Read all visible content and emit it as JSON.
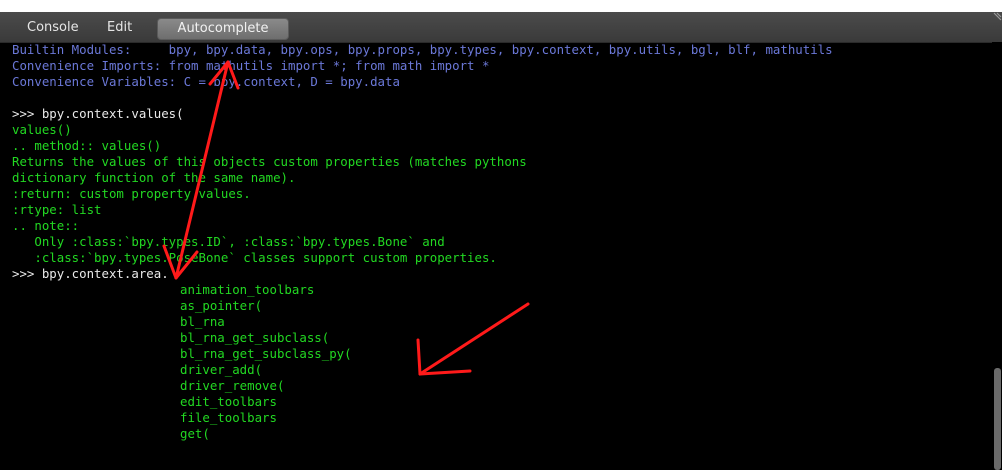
{
  "menu": {
    "console": "Console",
    "edit": "Edit",
    "autocomplete": "Autocomplete"
  },
  "header": {
    "builtin": "Builtin Modules:     bpy, bpy.data, bpy.ops, bpy.props, bpy.types, bpy.context, bpy.utils, bgl, blf, mathutils",
    "imports": "Convenience Imports: from mathutils import *; from math import *",
    "variables": "Convenience Variables: C = bpy.context, D = bpy.data"
  },
  "history": {
    "cmd1": ">>> bpy.context.values(",
    "doc": [
      "values()",
      ".. method:: values()",
      "Returns the values of this objects custom properties (matches pythons",
      "dictionary function of the same name).",
      ":return: custom property values.",
      ":rtype: list",
      ".. note::",
      "   Only :class:`bpy.types.ID`, :class:`bpy.types.Bone` and",
      "   :class:`bpy.types.PoseBone` classes support custom properties."
    ],
    "cmd2": ">>> bpy.context.area."
  },
  "autocomplete_items": [
    "animation_toolbars",
    "as_pointer(",
    "bl_rna",
    "bl_rna_get_subclass(",
    "bl_rna_get_subclass_py(",
    "driver_add(",
    "driver_remove(",
    "edit_toolbars",
    "file_toolbars",
    "get("
  ],
  "colors": {
    "background": "#000000",
    "info_text": "#6b78d8",
    "command_text": "#e9e9e9",
    "output_text": "#22d822",
    "annotation": "#ff1a1a"
  }
}
